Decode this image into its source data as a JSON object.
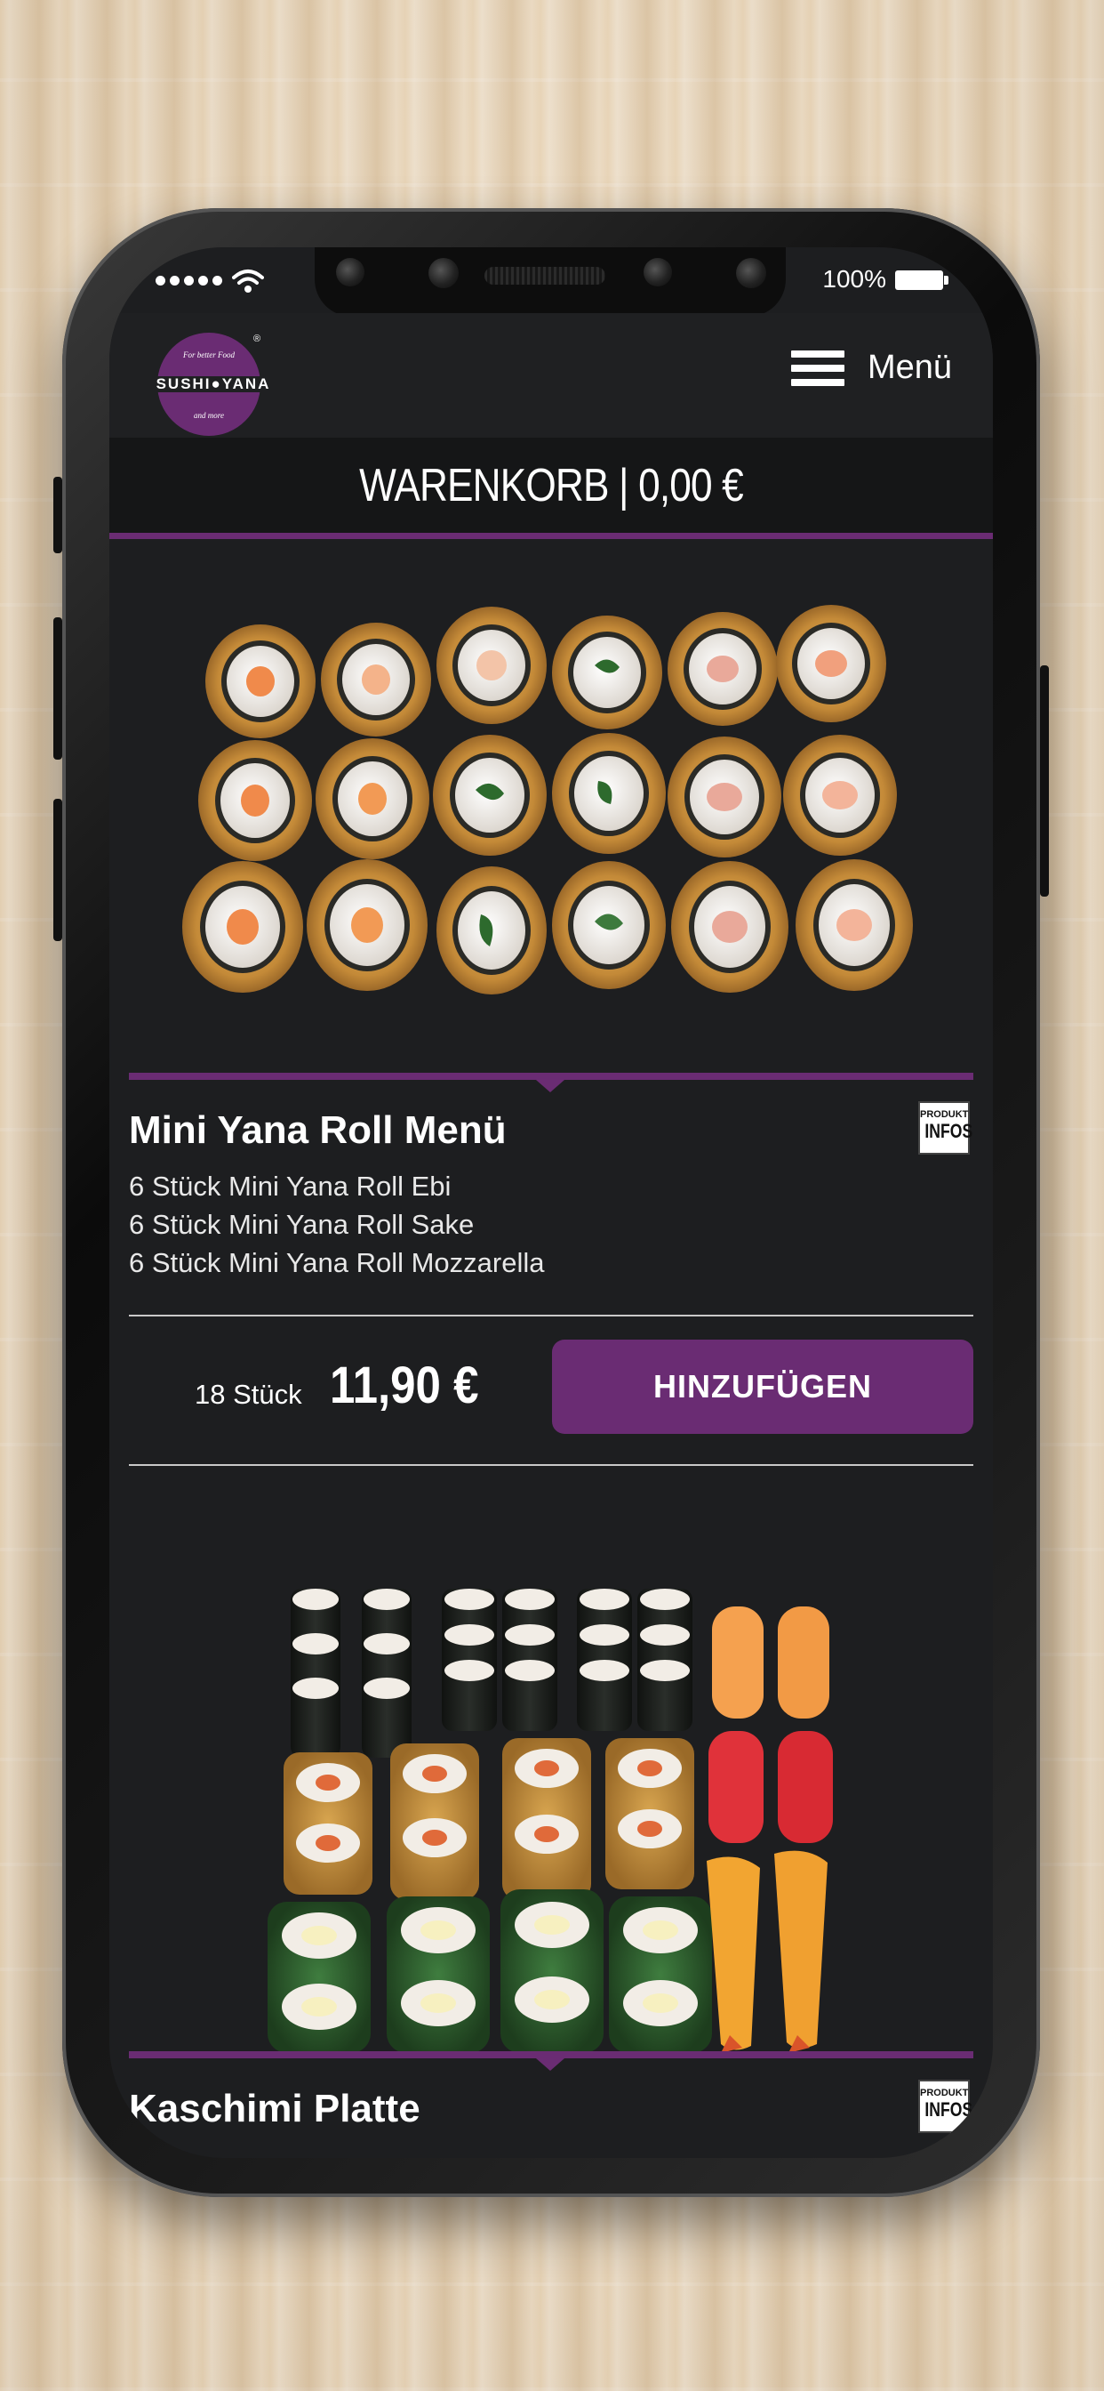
{
  "status_bar": {
    "battery_label": "100%"
  },
  "header": {
    "logo": {
      "top_text": "For better Food",
      "brand": "SUSHI●YANA",
      "bottom_text": "and more",
      "registered": "®"
    },
    "menu_label": "Menü"
  },
  "cart": {
    "label": "WARENKORB | 0,00 €"
  },
  "products": [
    {
      "title": "Mini Yana Roll Menü",
      "info_badge": {
        "small": "PRODUKT",
        "big": "INFOS"
      },
      "description": [
        "6 Stück Mini Yana Roll Ebi",
        "6 Stück Mini Yana Roll Sake",
        "6 Stück Mini Yana Roll Mozzarella"
      ],
      "quantity": "18 Stück",
      "price": "11,90 €",
      "add_label": "HINZUFÜGEN"
    },
    {
      "title": "Kaschimi Platte",
      "info_badge": {
        "small": "PRODUKT",
        "big": "INFOS"
      }
    }
  ],
  "colors": {
    "accent": "#6a2c73",
    "screen_bg": "#1d1e20",
    "cart_bar_bg": "#151617",
    "roll_crust": "#c8913e",
    "rice": "#f2ede6",
    "salmon": "#f08a4b",
    "nori": "#1a1d1a"
  },
  "icons": {
    "signal": "cellular-signal-icon",
    "wifi": "wifi-icon",
    "battery": "battery-icon",
    "menu": "hamburger-menu-icon",
    "info": "product-info-icon"
  }
}
